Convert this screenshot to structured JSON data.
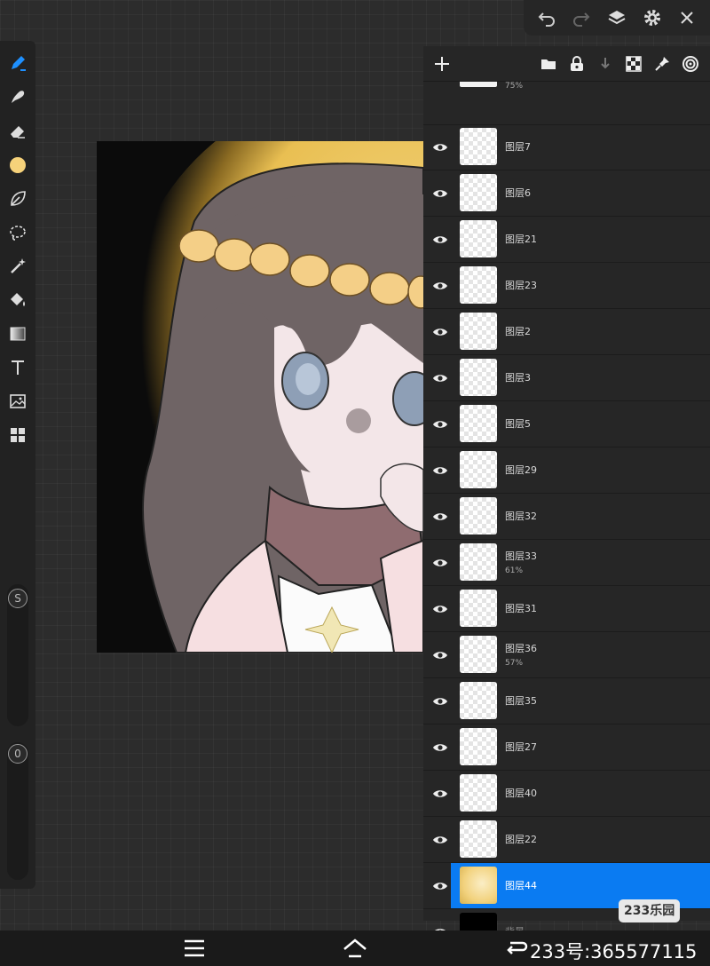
{
  "topbar": {
    "icons": [
      "undo-icon",
      "redo-icon",
      "layers-icon",
      "settings-icon",
      "close-icon"
    ]
  },
  "toolbar": {
    "tools": [
      "brush-icon",
      "smudge-icon",
      "eraser-icon",
      "color-swatch",
      "leaf-shape-icon",
      "lasso-icon",
      "magic-wand-icon",
      "fill-bucket-icon",
      "gradient-icon",
      "text-icon",
      "image-icon",
      "grid-icon"
    ],
    "active_color": "#f6d27a",
    "size_slider_label": "S",
    "opacity_slider_label": "0"
  },
  "layers_panel": {
    "header_icons": [
      "add-layer-icon",
      "folder-icon",
      "lock-icon",
      "merge-down-icon",
      "transparency-icon",
      "pin-icon",
      "target-icon"
    ],
    "partial_top_opacity": "75%",
    "layers": [
      {
        "name": "图层7",
        "opacity": ""
      },
      {
        "name": "图层6",
        "opacity": ""
      },
      {
        "name": "图层21",
        "opacity": ""
      },
      {
        "name": "图层23",
        "opacity": ""
      },
      {
        "name": "图层2",
        "opacity": ""
      },
      {
        "name": "图层3",
        "opacity": ""
      },
      {
        "name": "图层5",
        "opacity": ""
      },
      {
        "name": "图层29",
        "opacity": ""
      },
      {
        "name": "图层32",
        "opacity": ""
      },
      {
        "name": "图层33",
        "opacity": "61%"
      },
      {
        "name": "图层31",
        "opacity": ""
      },
      {
        "name": "图层36",
        "opacity": "57%"
      },
      {
        "name": "图层35",
        "opacity": ""
      },
      {
        "name": "图层27",
        "opacity": ""
      },
      {
        "name": "图层40",
        "opacity": ""
      },
      {
        "name": "图层22",
        "opacity": ""
      },
      {
        "name": "图层44",
        "opacity": "",
        "selected": true
      },
      {
        "name": "背景",
        "opacity": ""
      }
    ],
    "accent_color": "#0a7bf2"
  },
  "watermark": {
    "logo_text": "233乐园",
    "qq_text": "233号:365577115"
  },
  "navbar": {
    "icons": [
      "menu-icon",
      "home-icon",
      "back-icon"
    ]
  }
}
